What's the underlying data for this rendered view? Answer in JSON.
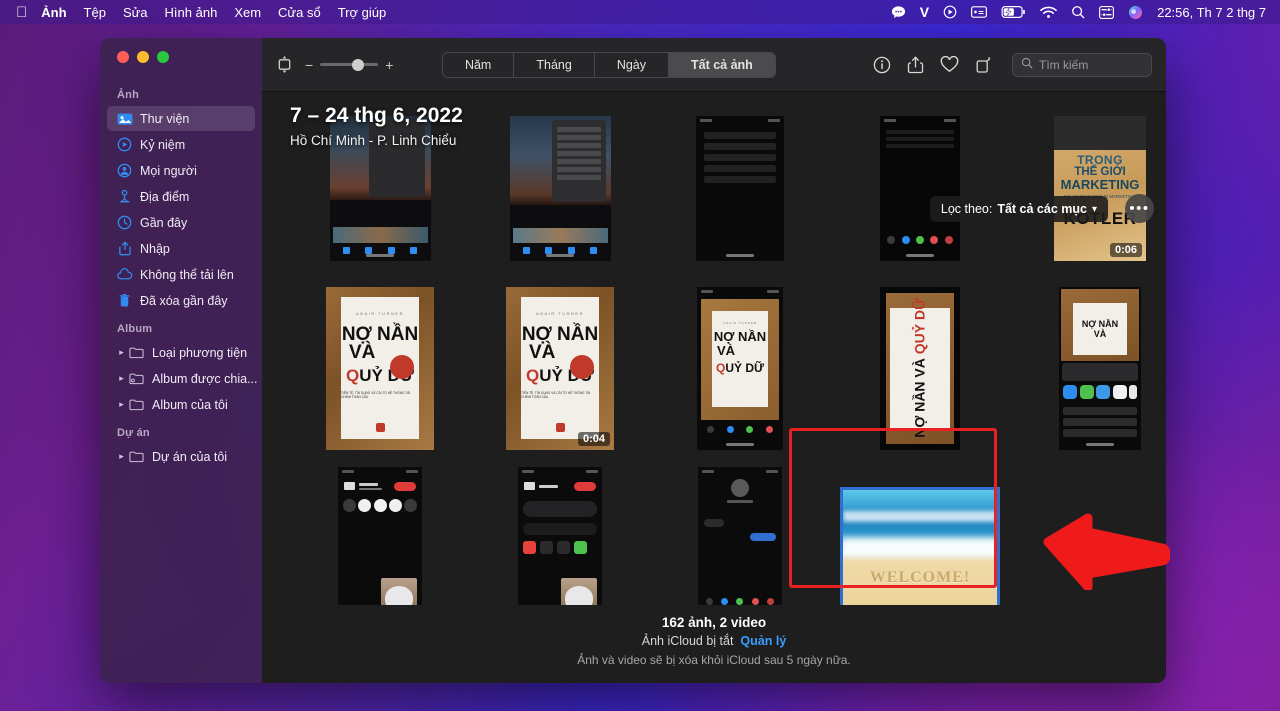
{
  "menubar": {
    "apple_icon": "apple-logo",
    "items": [
      {
        "label": "Ảnh",
        "bold": true
      },
      {
        "label": "Tệp",
        "bold": false
      },
      {
        "label": "Sửa",
        "bold": false
      },
      {
        "label": "Hình ảnh",
        "bold": false
      },
      {
        "label": "Xem",
        "bold": false
      },
      {
        "label": "Cửa sổ",
        "bold": false
      },
      {
        "label": "Trợ giúp",
        "bold": false
      }
    ],
    "status_icons": [
      "chat-bubble-icon",
      "letter-v-icon",
      "play-circle-icon",
      "display-icon",
      "battery-charging-icon",
      "wifi-icon",
      "spotlight-search-icon",
      "control-center-icon",
      "siri-icon"
    ],
    "clock": "22:56, Th 7 2 thg 7"
  },
  "window": {
    "traffic_lights": [
      "close",
      "minimize",
      "zoom"
    ]
  },
  "sidebar": {
    "sections": [
      {
        "title": "Ảnh",
        "items": [
          {
            "label": "Thư viện",
            "icon": "photos-library-icon",
            "active": true
          },
          {
            "label": "Kỷ niệm",
            "icon": "memories-icon",
            "active": false
          },
          {
            "label": "Mọi người",
            "icon": "people-icon",
            "active": false
          },
          {
            "label": "Địa điểm",
            "icon": "places-pin-icon",
            "active": false
          },
          {
            "label": "Gần đây",
            "icon": "recent-clock-icon",
            "active": false
          },
          {
            "label": "Nhập",
            "icon": "import-icon",
            "active": false
          },
          {
            "label": "Không thể tải lên",
            "icon": "cloud-upload-failed-icon",
            "active": false
          },
          {
            "label": "Đã xóa gần đây",
            "icon": "trash-icon",
            "active": false
          }
        ]
      },
      {
        "title": "Album",
        "items": [
          {
            "label": "Loại phương tiện",
            "icon": "folder-icon",
            "disclosure": true
          },
          {
            "label": "Album được chia...",
            "icon": "shared-folder-icon",
            "disclosure": true
          },
          {
            "label": "Album của tôi",
            "icon": "folder-icon",
            "disclosure": true
          }
        ]
      },
      {
        "title": "Dự án",
        "items": [
          {
            "label": "Dự án của tôi",
            "icon": "folder-icon",
            "disclosure": true
          }
        ]
      }
    ]
  },
  "toolbar": {
    "layout_icon": "aspect-ratio-icon",
    "zoom_minus": "−",
    "zoom_plus": "+",
    "tabs": [
      {
        "label": "Năm",
        "active": false
      },
      {
        "label": "Tháng",
        "active": false
      },
      {
        "label": "Ngày",
        "active": false
      },
      {
        "label": "Tất cả ảnh",
        "active": true
      }
    ],
    "right_icons": [
      "info-icon",
      "share-icon",
      "favorite-heart-icon",
      "rotate-icon"
    ],
    "search": {
      "placeholder": "Tìm kiếm",
      "icon": "search-icon",
      "value": ""
    }
  },
  "content": {
    "header": {
      "date_range": "7 – 24 thg 6, 2022",
      "location": "Hồ Chí Minh - P. Linh Chiểu"
    },
    "filter": {
      "prefix": "Lọc theo:",
      "value": "Tất cả các mục",
      "chevron": "chevron-down-icon"
    },
    "more_button": "•••",
    "photos": [
      {
        "id": "p1",
        "type": "phone-screenshot-photo-editor",
        "duration": ""
      },
      {
        "id": "p2",
        "type": "phone-screenshot-share-sheet",
        "duration": ""
      },
      {
        "id": "p3",
        "type": "phone-screenshot-dark-menu",
        "duration": ""
      },
      {
        "id": "p4",
        "type": "phone-screenshot-call-dark",
        "duration": ""
      },
      {
        "id": "p5",
        "type": "book-kotler-marketing",
        "duration": "0:06"
      },
      {
        "id": "p6",
        "type": "book-no-nan-va-quy-du",
        "duration": ""
      },
      {
        "id": "p7",
        "type": "book-no-nan-va-quy-du",
        "duration": "0:04"
      },
      {
        "id": "p8",
        "type": "phone-book-cover-dark",
        "duration": ""
      },
      {
        "id": "p9",
        "type": "phone-book-rotated",
        "duration": ""
      },
      {
        "id": "p10",
        "type": "phone-share-sheet-book",
        "duration": ""
      },
      {
        "id": "p11",
        "type": "phone-facetime-cat",
        "duration": ""
      },
      {
        "id": "p12",
        "type": "phone-facetime-messages",
        "duration": ""
      },
      {
        "id": "p13",
        "type": "phone-chat-thread",
        "duration": ""
      },
      {
        "id": "p14",
        "type": "beach-welcome-photo",
        "duration": "",
        "selected": true,
        "caption": "WELCOME!"
      }
    ]
  },
  "footer": {
    "count": "162 ảnh, 2 video",
    "icloud_status": "Ảnh iCloud bị tắt",
    "manage_link": "Quản lý",
    "notice": "Ảnh và video sẽ bị xóa khỏi iCloud sau 5 ngày nữa."
  },
  "annotations": {
    "arrow": "red-arrow-pointing-left",
    "highlight": "red-rectangle-around-selected-photo"
  },
  "colors": {
    "accent_blue": "#3b9dff",
    "annotation_red": "#e82222",
    "selection_blue": "#2f6fd0",
    "window_bg": "#1e1e1e",
    "toolbar_bg": "#262628"
  }
}
